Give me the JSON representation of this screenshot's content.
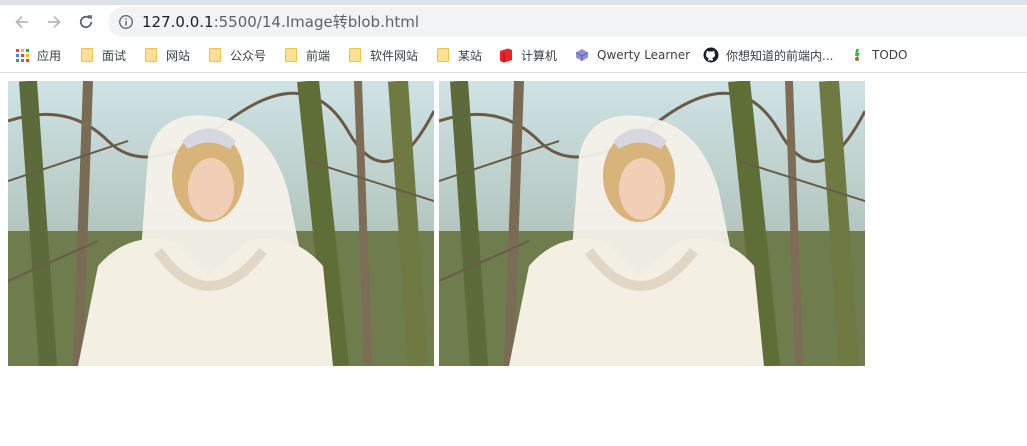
{
  "browser": {
    "nav": {
      "back_icon": "arrow-left-icon",
      "forward_icon": "arrow-right-icon",
      "reload_icon": "reload-icon"
    },
    "address_bar": {
      "icon": "info-icon",
      "url_host": "127.0.0.1",
      "url_path": ":5500/14.Image转blob.html"
    }
  },
  "bookmarks": [
    {
      "label": "应用",
      "icon": "apps-grid-icon"
    },
    {
      "label": "面试",
      "icon": "folder-icon"
    },
    {
      "label": "网站",
      "icon": "folder-icon"
    },
    {
      "label": "公众号",
      "icon": "folder-icon"
    },
    {
      "label": "前端",
      "icon": "folder-icon"
    },
    {
      "label": "软件网站",
      "icon": "folder-icon"
    },
    {
      "label": "某站",
      "icon": "folder-icon"
    },
    {
      "label": "计算机",
      "icon": "red-book-icon"
    },
    {
      "label": "Qwerty Learner",
      "icon": "purple-cube-icon"
    },
    {
      "label": "你想知道的前端内...",
      "icon": "github-icon"
    },
    {
      "label": "TODO",
      "icon": "todo-icon"
    }
  ],
  "page": {
    "images": [
      {
        "description_icon": "bride-photo-original"
      },
      {
        "description_icon": "bride-photo-blob-copy"
      }
    ]
  },
  "colors": {
    "chrome_bg": "#dee1e6",
    "omnibox_bg": "#f1f3f4",
    "folder_yellow": "#fde293"
  }
}
